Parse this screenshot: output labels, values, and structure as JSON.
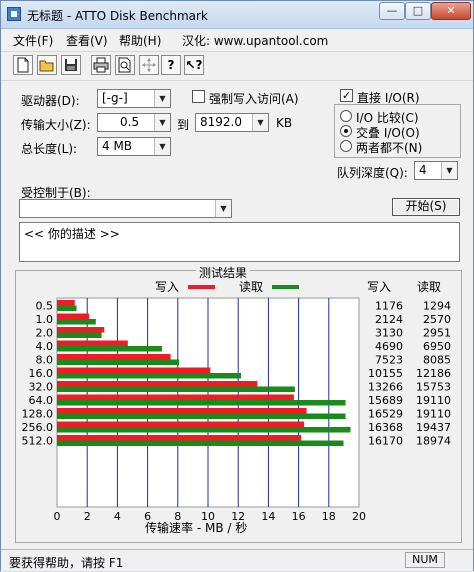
{
  "window": {
    "title": "无标题 - ATTO Disk Benchmark"
  },
  "menu": {
    "file": "文件(F)",
    "view": "查看(V)",
    "help": "帮助(H)",
    "localize": "汉化: www.upantool.com"
  },
  "toolbar": {
    "icons": [
      "new-icon",
      "open-icon",
      "save-icon",
      "print-icon",
      "print-preview-icon",
      "move-icon",
      "help-icon",
      "context-help-icon"
    ]
  },
  "settings": {
    "drive_label": "驱动器(D):",
    "drive_value": "[-g-]",
    "force_write_label": "强制写入访问(A)",
    "transfer_label": "传输大小(Z):",
    "transfer_from": "0.5",
    "to_label": "到",
    "transfer_to": "8192.0",
    "kb_label": "KB",
    "total_label": "总长度(L):",
    "total_value": "4 MB",
    "direct_io_label": "直接 I/O(R)",
    "io_compare_label": "I/O 比较(C)",
    "io_overlap_label": "交叠 I/O(O)",
    "neither_label": "两者都不(N)",
    "queue_label": "队列深度(Q):",
    "queue_value": "4",
    "controlled_label": "受控制于(B):",
    "controlled_value": "",
    "start_button": "开始(S)",
    "description": "<<  你的描述  >>"
  },
  "results": {
    "section_title": "测试结果",
    "legend_write": "写入",
    "legend_read": "读取",
    "col_write": "写入",
    "col_read": "读取",
    "write_color": "#ee1c24",
    "read_color": "#1a8a1a"
  },
  "chart_data": {
    "type": "bar",
    "orientation": "horizontal",
    "categories": [
      "0.5",
      "1.0",
      "2.0",
      "4.0",
      "8.0",
      "16.0",
      "32.0",
      "64.0",
      "128.0",
      "256.0",
      "512.0"
    ],
    "series": [
      {
        "name": "写入",
        "values": [
          1176,
          2124,
          3130,
          4690,
          7523,
          10155,
          13266,
          15689,
          16529,
          16368,
          16170
        ]
      },
      {
        "name": "读取",
        "values": [
          1294,
          2570,
          2951,
          6950,
          8085,
          12186,
          15753,
          19110,
          19110,
          19437,
          18974
        ]
      }
    ],
    "xlabel": "传输速率 - MB / 秒",
    "xticks": [
      "0",
      "2",
      "4",
      "6",
      "8",
      "10",
      "12",
      "14",
      "16",
      "18",
      "20"
    ],
    "xlim": [
      0,
      20
    ],
    "grid": true,
    "legend": "top"
  },
  "status": {
    "help_text": "要获得帮助，请按 F1",
    "num": "NUM"
  }
}
